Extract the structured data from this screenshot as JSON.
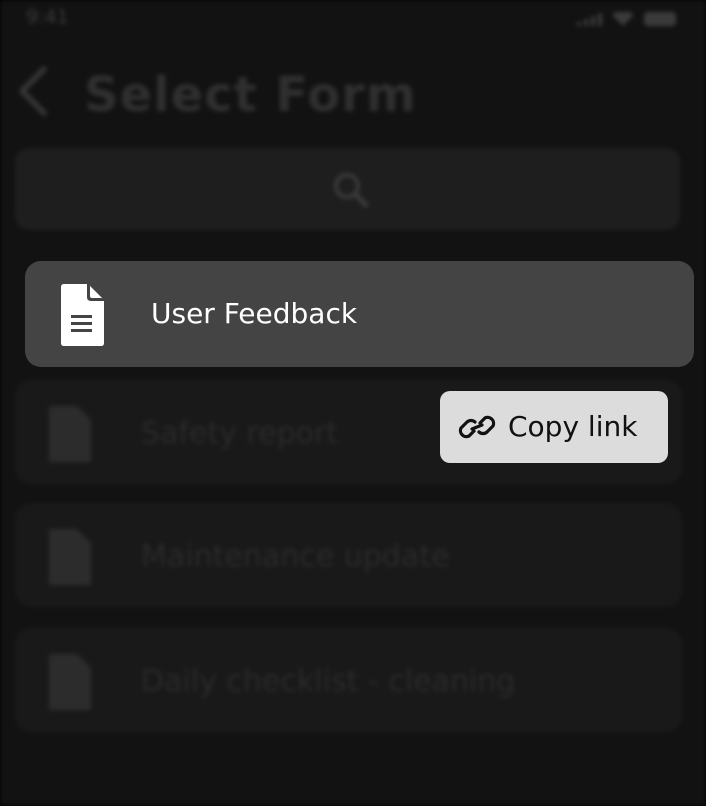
{
  "status_bar": {
    "time": "9:41"
  },
  "header": {
    "title": "Select Form"
  },
  "search": {
    "icon": "search-icon"
  },
  "forms": [
    {
      "label": "User Feedback",
      "icon": "document-icon"
    },
    {
      "label": "Safety report",
      "icon": "document-icon"
    },
    {
      "label": "Maintenance update",
      "icon": "document-icon"
    },
    {
      "label": "Daily checklist - cleaning",
      "icon": "document-icon"
    }
  ],
  "context_menu": {
    "copy_link_label": "Copy link",
    "icon": "link-icon"
  },
  "colors": {
    "overlay": "#000000",
    "focused_item": "#444444",
    "menu_bg": "#dcdcdc"
  }
}
